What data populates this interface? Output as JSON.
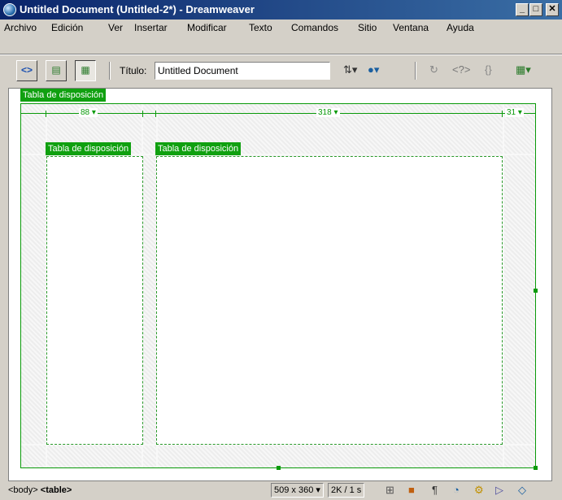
{
  "window": {
    "title": "Untitled Document (Untitled-2*) - Dreamweaver"
  },
  "menubar": {
    "items": [
      "Archivo",
      "Edición",
      "Ver",
      "Insertar",
      "Modificar",
      "Texto",
      "Comandos",
      "Sitio",
      "Ventana",
      "Ayuda"
    ]
  },
  "toolbar": {
    "title_label": "Título:",
    "title_value": "Untitled Document",
    "code_view_glyph": "<>",
    "code_tags_glyph": "<?>",
    "braces_glyph": "{}"
  },
  "layout": {
    "outer_label": "Tabla de disposición",
    "cell1_label": "Tabla de disposición",
    "cell2_label": "Tabla de disposición",
    "widths": [
      "88",
      "318",
      "31"
    ]
  },
  "statusbar": {
    "tag_body": "<body>",
    "tag_table": "<table>",
    "window_size": "509 x 360",
    "download": "2K / 1 s"
  },
  "colors": {
    "layout_green": "#10a010",
    "title_bar": "#0a246a"
  }
}
